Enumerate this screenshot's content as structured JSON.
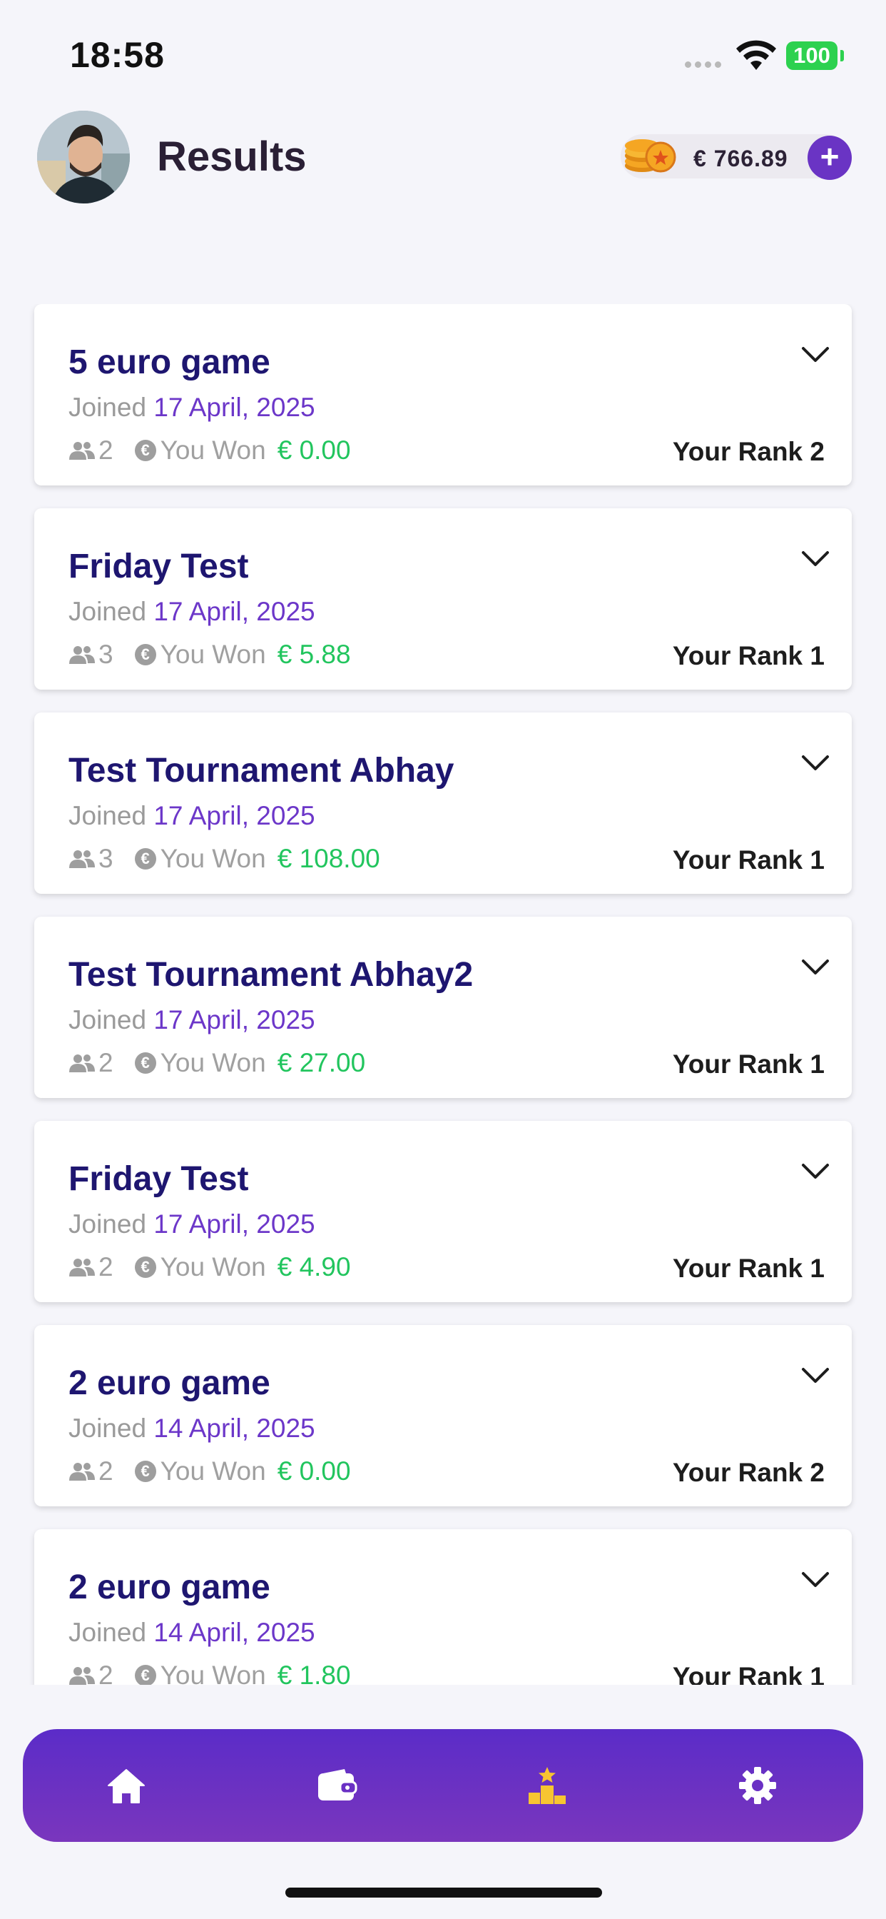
{
  "status_bar": {
    "time": "18:58",
    "battery": "100"
  },
  "header": {
    "title": "Results",
    "wallet_amount": "€ 766.89",
    "add_label": "+"
  },
  "labels": {
    "joined": "Joined",
    "you_won": "You Won",
    "euro_symbol": "€"
  },
  "results": [
    {
      "title": "5 euro game",
      "date": "17 April, 2025",
      "players": "2",
      "won": "€ 0.00",
      "rank": "Your Rank 2"
    },
    {
      "title": "Friday Test",
      "date": "17 April, 2025",
      "players": "3",
      "won": "€ 5.88",
      "rank": "Your Rank 1"
    },
    {
      "title": "Test Tournament Abhay",
      "date": "17 April, 2025",
      "players": "3",
      "won": "€ 108.00",
      "rank": "Your Rank 1"
    },
    {
      "title": "Test Tournament Abhay2",
      "date": "17 April, 2025",
      "players": "2",
      "won": "€ 27.00",
      "rank": "Your Rank 1"
    },
    {
      "title": "Friday Test",
      "date": "17 April, 2025",
      "players": "2",
      "won": "€ 4.90",
      "rank": "Your Rank 1"
    },
    {
      "title": "2 euro game",
      "date": "14 April, 2025",
      "players": "2",
      "won": "€ 0.00",
      "rank": "Your Rank 2"
    },
    {
      "title": "2 euro game",
      "date": "14 April, 2025",
      "players": "2",
      "won": "€ 1.80",
      "rank": "Your Rank 1"
    }
  ],
  "nav": [
    {
      "icon": "home-icon"
    },
    {
      "icon": "wallet-icon"
    },
    {
      "icon": "leaderboard-icon"
    },
    {
      "icon": "settings-icon"
    }
  ],
  "colors": {
    "accent": "#6a34c4",
    "title_text": "#1e1670",
    "won_green": "#22c55e",
    "leaderboard_yellow": "#f7c531"
  }
}
